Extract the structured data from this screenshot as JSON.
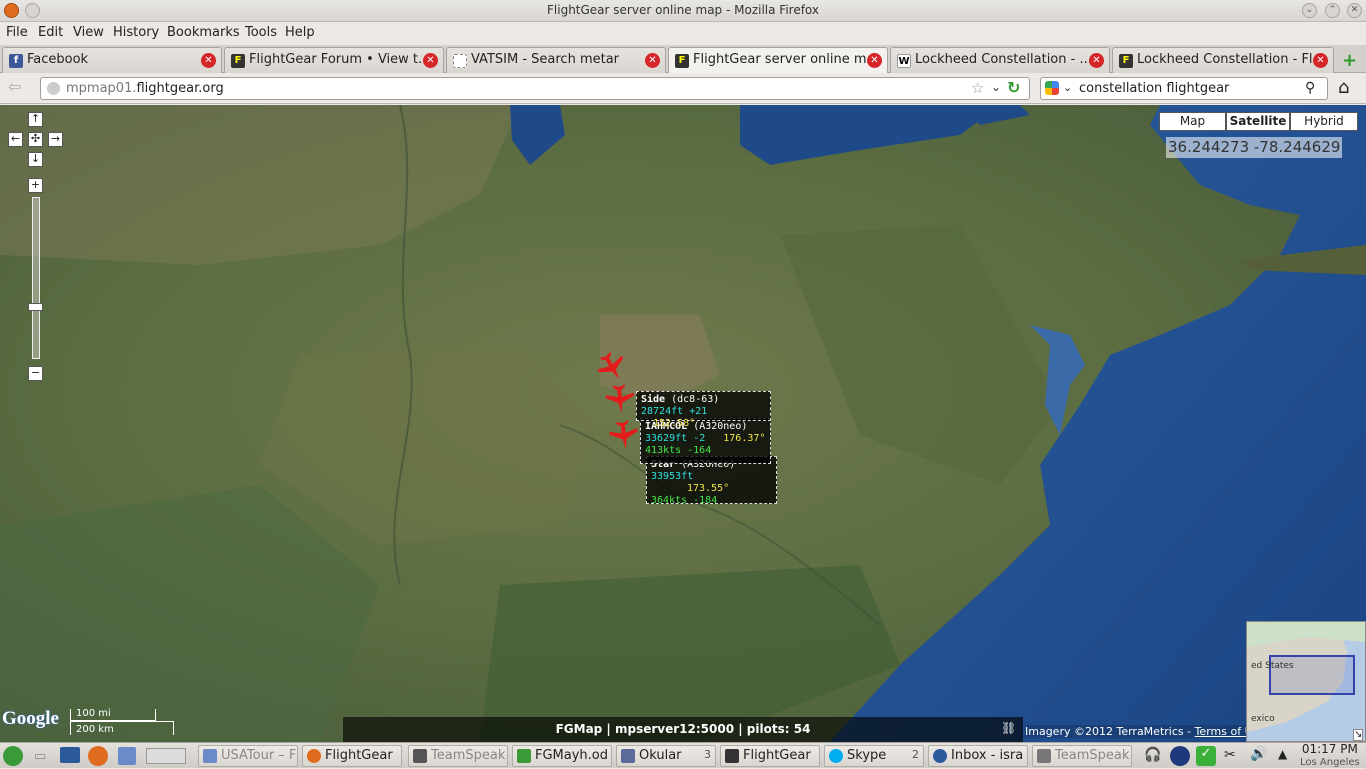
{
  "window": {
    "title": "FlightGear server online map - Mozilla Firefox"
  },
  "menu": [
    "File",
    "Edit",
    "View",
    "History",
    "Bookmarks",
    "Tools",
    "Help"
  ],
  "tabs": [
    {
      "label": "Facebook",
      "icon": "facebook-icon"
    },
    {
      "label": "FlightGear Forum • View t...",
      "icon": "flightgear-icon"
    },
    {
      "label": "VATSIM - Search metar",
      "icon": "page-icon"
    },
    {
      "label": "FlightGear server online m...",
      "icon": "flightgear-icon"
    },
    {
      "label": "Lockheed Constellation - ...",
      "icon": "wikipedia-icon"
    },
    {
      "label": "Lockheed Constellation - Fl...",
      "icon": "flightgear-icon"
    }
  ],
  "url": {
    "prefix": "mpmap01.",
    "domain": "flightgear.org"
  },
  "search": {
    "value": "constellation flightgear"
  },
  "map": {
    "types": [
      "Map",
      "Satellite",
      "Hybrid"
    ],
    "selected_type": "Satellite",
    "coords": "36.244273 -78.244629",
    "scale_top": "100 mi",
    "scale_bottom": "200 km",
    "google_logo": "Google",
    "status": "FGMap | mpserver12:5000 | pilots: 54",
    "imagery_text": "Imagery ©2012 TerraMetrics - ",
    "terms_link": "Terms of Use",
    "overview_label": "ed States",
    "overview_label2": "exico"
  },
  "aircraft": [
    {
      "callsign": "Side",
      "model": "(dc8-63)",
      "alt": "28724ft",
      "vs": "+21",
      "hdg": "152.58°",
      "speed": ""
    },
    {
      "callsign": "IAHMCOL",
      "model": "(A320neo)",
      "alt": "33629ft",
      "vs": "-2",
      "hdg": "176.37°",
      "speed": "413kts -164"
    },
    {
      "callsign": "Star",
      "model": "(A320neo)",
      "alt": "33953ft",
      "vs": "",
      "hdg": "173.55°",
      "speed": "364kts -184"
    }
  ],
  "taskbar": [
    {
      "label": "USATour – F",
      "dim": true
    },
    {
      "label": "FlightGear",
      "dim": false
    },
    {
      "label": "TeamSpeak",
      "dim": true
    },
    {
      "label": "FGMayh.od",
      "dim": false
    },
    {
      "label": "Okular",
      "dim": false,
      "count": "3"
    },
    {
      "label": "FlightGear",
      "dim": false
    },
    {
      "label": "Skype",
      "dim": false,
      "count": "2"
    },
    {
      "label": "Inbox - isra",
      "dim": false
    },
    {
      "label": "TeamSpeak",
      "dim": true
    }
  ],
  "clock": {
    "time": "01:17 PM",
    "zone": "Los Angeles"
  },
  "colors": {
    "accent_red": "#e41b1b",
    "label_cyan": "#2ee0e0",
    "label_green": "#45e64a",
    "label_yellow": "#f4e44a"
  }
}
